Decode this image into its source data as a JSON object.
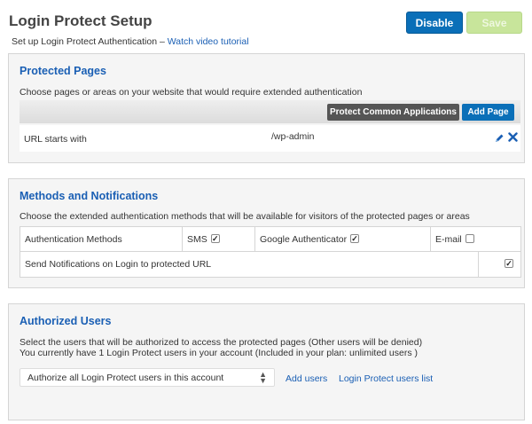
{
  "header": {
    "title": "Login Protect Setup",
    "subtitle": "Set up Login Protect Authentication –",
    "video_link": "Watch video tutorial",
    "disable_label": "Disable",
    "save_label": "Save"
  },
  "protected_pages": {
    "title": "Protected Pages",
    "description": "Choose pages or areas on your website that would require extended authentication",
    "protect_common_label": "Protect Common Applications",
    "add_page_label": "Add Page",
    "rows": [
      {
        "condition": "URL starts with",
        "value": "/wp-admin"
      }
    ]
  },
  "methods": {
    "title": "Methods and Notifications",
    "description": "Choose the extended authentication methods that will be available for visitors of the protected pages or areas",
    "auth_label": "Authentication Methods",
    "options": [
      {
        "label": "SMS",
        "checked": true
      },
      {
        "label": "Google Authenticator",
        "checked": true
      },
      {
        "label": "E-mail",
        "checked": false
      }
    ],
    "notify_label": "Send Notifications on Login to protected URL",
    "notify_checked": true
  },
  "authorized": {
    "title": "Authorized Users",
    "desc_line1": "Select the users that will be authorized to access the protected pages (Other users will be denied)",
    "desc_line2": "You currently have 1 Login Protect users in your account (Included in your plan: unlimited users )",
    "select_value": "Authorize all Login Protect users in this account",
    "add_users_label": "Add users",
    "users_list_label": "Login Protect users list"
  },
  "colors": {
    "primary": "#0a6fb8",
    "title_blue": "#1a5fb4",
    "save_disabled": "#c8e59b"
  }
}
